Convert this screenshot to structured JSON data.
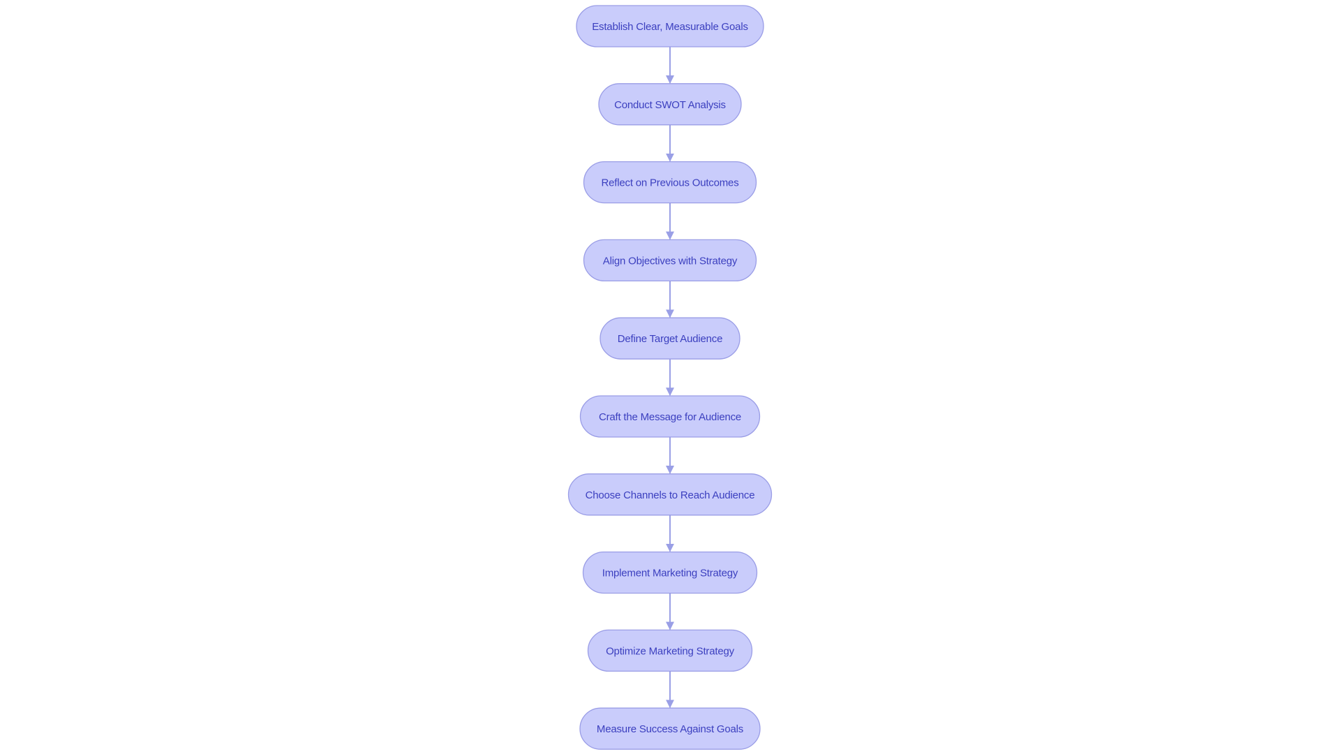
{
  "diagram": {
    "type": "flowchart",
    "direction": "top-to-bottom",
    "colors": {
      "node_fill": "#c9ccfb",
      "node_border": "#9a9de6",
      "node_text": "#3b3fbf",
      "edge": "#9a9fe6",
      "background": "#ffffff"
    },
    "nodes": [
      {
        "id": "n1",
        "label": "Establish Clear, Measurable Goals"
      },
      {
        "id": "n2",
        "label": "Conduct SWOT Analysis"
      },
      {
        "id": "n3",
        "label": "Reflect on Previous Outcomes"
      },
      {
        "id": "n4",
        "label": "Align Objectives with Strategy"
      },
      {
        "id": "n5",
        "label": "Define Target Audience"
      },
      {
        "id": "n6",
        "label": "Craft the Message for Audience"
      },
      {
        "id": "n7",
        "label": "Choose Channels to Reach Audience"
      },
      {
        "id": "n8",
        "label": "Implement Marketing Strategy"
      },
      {
        "id": "n9",
        "label": "Optimize Marketing Strategy"
      },
      {
        "id": "n10",
        "label": "Measure Success Against Goals"
      }
    ],
    "edges": [
      {
        "from": "n1",
        "to": "n2"
      },
      {
        "from": "n2",
        "to": "n3"
      },
      {
        "from": "n3",
        "to": "n4"
      },
      {
        "from": "n4",
        "to": "n5"
      },
      {
        "from": "n5",
        "to": "n6"
      },
      {
        "from": "n6",
        "to": "n7"
      },
      {
        "from": "n7",
        "to": "n8"
      },
      {
        "from": "n8",
        "to": "n9"
      },
      {
        "from": "n9",
        "to": "n10"
      }
    ]
  }
}
